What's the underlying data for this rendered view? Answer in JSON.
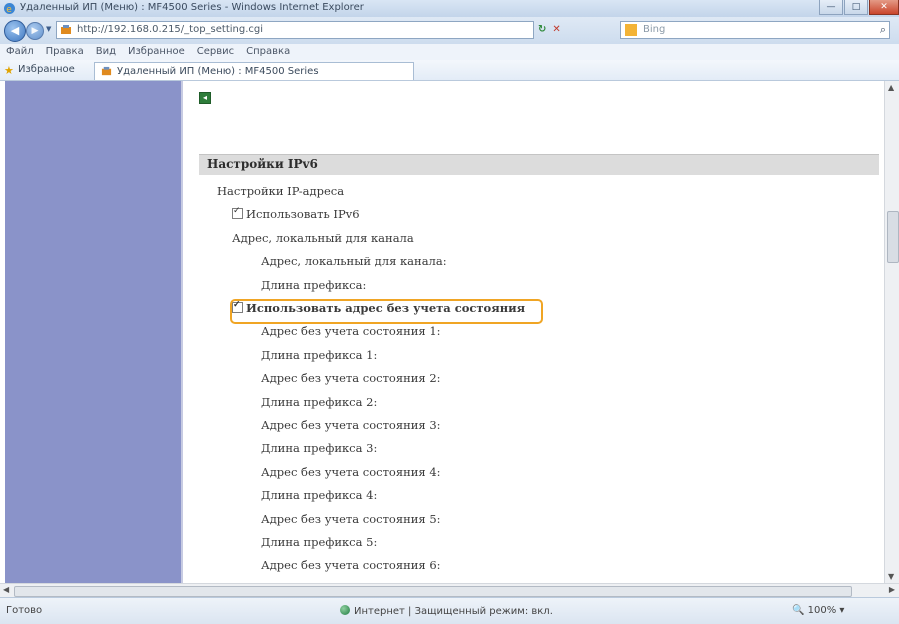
{
  "window": {
    "title": "Удаленный ИП (Меню) : MF4500 Series - Windows Internet Explorer",
    "buttons": {
      "minimize": "—",
      "maximize": "□",
      "close": "✕"
    }
  },
  "address_bar": {
    "url": "http://192.168.0.215/_top_setting.cgi",
    "refresh": "↻",
    "stop": "✕",
    "search_placeholder": "Bing",
    "search_button": "⌕"
  },
  "menu": [
    "Файл",
    "Правка",
    "Вид",
    "Избранное",
    "Сервис",
    "Справка"
  ],
  "favorites": {
    "label": "Избранное",
    "tab_title": "Удаленный ИП (Меню) : MF4500 Series"
  },
  "content": {
    "section_title": "Настройки IPv6",
    "rows": [
      {
        "text": "Настройки IP-адреса",
        "level": 1,
        "bold": false,
        "checkbox": false
      },
      {
        "text": "Использовать IPv6",
        "level": 2,
        "bold": false,
        "checkbox": true
      },
      {
        "text": "Адрес, локальный для канала",
        "level": 2,
        "bold": false,
        "checkbox": false
      },
      {
        "text": "Адрес, локальный для канала:",
        "level": 3,
        "bold": false,
        "checkbox": false
      },
      {
        "text": "Длина префикса:",
        "level": 3,
        "bold": false,
        "checkbox": false
      },
      {
        "text": "Использовать адрес без учета состояния",
        "level": 2,
        "bold": true,
        "checkbox": true,
        "highlighted": true
      },
      {
        "text": "Адрес без учета состояния 1:",
        "level": 3,
        "bold": false,
        "checkbox": false
      },
      {
        "text": "Длина префикса 1:",
        "level": 3,
        "bold": false,
        "checkbox": false
      },
      {
        "text": "Адрес без учета состояния 2:",
        "level": 3,
        "bold": false,
        "checkbox": false
      },
      {
        "text": "Длина префикса 2:",
        "level": 3,
        "bold": false,
        "checkbox": false
      },
      {
        "text": "Адрес без учета состояния 3:",
        "level": 3,
        "bold": false,
        "checkbox": false
      },
      {
        "text": "Длина префикса 3:",
        "level": 3,
        "bold": false,
        "checkbox": false
      },
      {
        "text": "Адрес без учета состояния 4:",
        "level": 3,
        "bold": false,
        "checkbox": false
      },
      {
        "text": "Длина префикса 4:",
        "level": 3,
        "bold": false,
        "checkbox": false
      },
      {
        "text": "Адрес без учета состояния 5:",
        "level": 3,
        "bold": false,
        "checkbox": false
      },
      {
        "text": "Длина префикса 5:",
        "level": 3,
        "bold": false,
        "checkbox": false
      },
      {
        "text": "Адрес без учета состояния 6:",
        "level": 3,
        "bold": false,
        "checkbox": false
      }
    ]
  },
  "status_bar": {
    "left": "Готово",
    "zone": "Интернет | Защищенный режим: вкл.",
    "zoom": "100%"
  },
  "colors": {
    "sidebar": "#8a93c9",
    "highlight": "#f0a524",
    "section_header": "#dcdcdc"
  }
}
